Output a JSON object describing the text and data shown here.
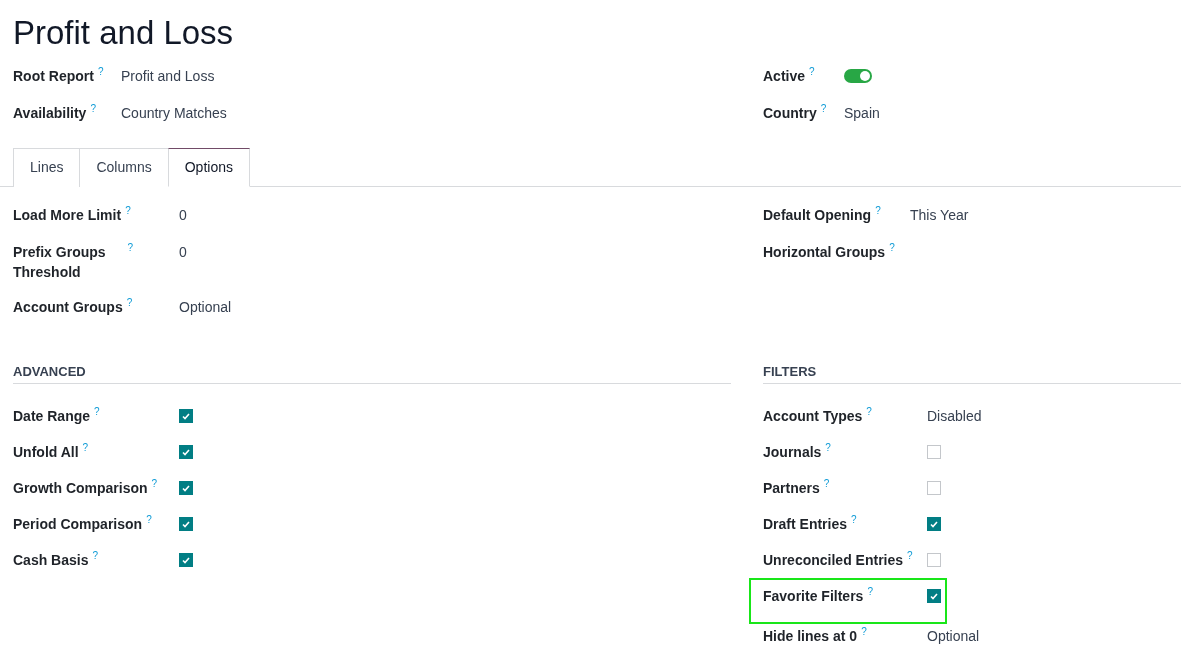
{
  "title": "Profit and Loss",
  "header_left": [
    {
      "label": "Root Report",
      "help": "?",
      "kind": "text",
      "value": "Profit and Loss"
    },
    {
      "label": "Availability",
      "help": "?",
      "kind": "text",
      "value": "Country Matches"
    }
  ],
  "header_right": [
    {
      "label": "Active",
      "help": "?",
      "kind": "toggle",
      "on": true
    },
    {
      "label": "Country",
      "help": "?",
      "kind": "text",
      "value": "Spain"
    }
  ],
  "tabs": [
    {
      "label": "Lines",
      "selected": false
    },
    {
      "label": "Columns",
      "selected": false
    },
    {
      "label": "Options",
      "selected": true
    }
  ],
  "options_left": [
    {
      "label": "Load More Limit",
      "help": "?",
      "kind": "text",
      "value": "0"
    },
    {
      "label": "Prefix Groups Threshold",
      "help": "?",
      "kind": "text",
      "value": "0"
    },
    {
      "label": "Account Groups",
      "help": "?",
      "kind": "text",
      "value": "Optional"
    }
  ],
  "options_right": [
    {
      "label": "Default Opening",
      "help": "?",
      "kind": "text",
      "value": "This Year"
    },
    {
      "label": "Horizontal Groups",
      "help": "?",
      "kind": "empty"
    }
  ],
  "sections": [
    {
      "title": "ADVANCED",
      "rows": [
        {
          "label": "Date Range",
          "help": "?",
          "kind": "checkbox",
          "checked": true,
          "highlighted": false
        },
        {
          "label": "Unfold All",
          "help": "?",
          "kind": "checkbox",
          "checked": true,
          "highlighted": false
        },
        {
          "label": "Growth Comparison",
          "help": "?",
          "kind": "checkbox",
          "checked": true,
          "highlighted": false
        },
        {
          "label": "Period Comparison",
          "help": "?",
          "kind": "checkbox",
          "checked": true,
          "highlighted": false
        },
        {
          "label": "Cash Basis",
          "help": "?",
          "kind": "checkbox",
          "checked": true,
          "highlighted": false
        }
      ]
    },
    {
      "title": "FILTERS",
      "rows": [
        {
          "label": "Account Types",
          "help": "?",
          "kind": "text",
          "value": "Disabled",
          "highlighted": false
        },
        {
          "label": "Journals",
          "help": "?",
          "kind": "checkbox",
          "checked": false,
          "highlighted": false
        },
        {
          "label": "Partners",
          "help": "?",
          "kind": "checkbox",
          "checked": false,
          "highlighted": false
        },
        {
          "label": "Draft Entries",
          "help": "?",
          "kind": "checkbox",
          "checked": true,
          "highlighted": false
        },
        {
          "label": "Unreconciled Entries",
          "help": "?",
          "kind": "checkbox",
          "checked": false,
          "highlighted": false
        },
        {
          "label": "Favorite Filters",
          "help": "?",
          "kind": "checkbox",
          "checked": true,
          "highlighted": true
        },
        {
          "label": "Hide lines at 0",
          "help": "?",
          "kind": "text",
          "value": "Optional",
          "highlighted": false
        }
      ]
    }
  ]
}
